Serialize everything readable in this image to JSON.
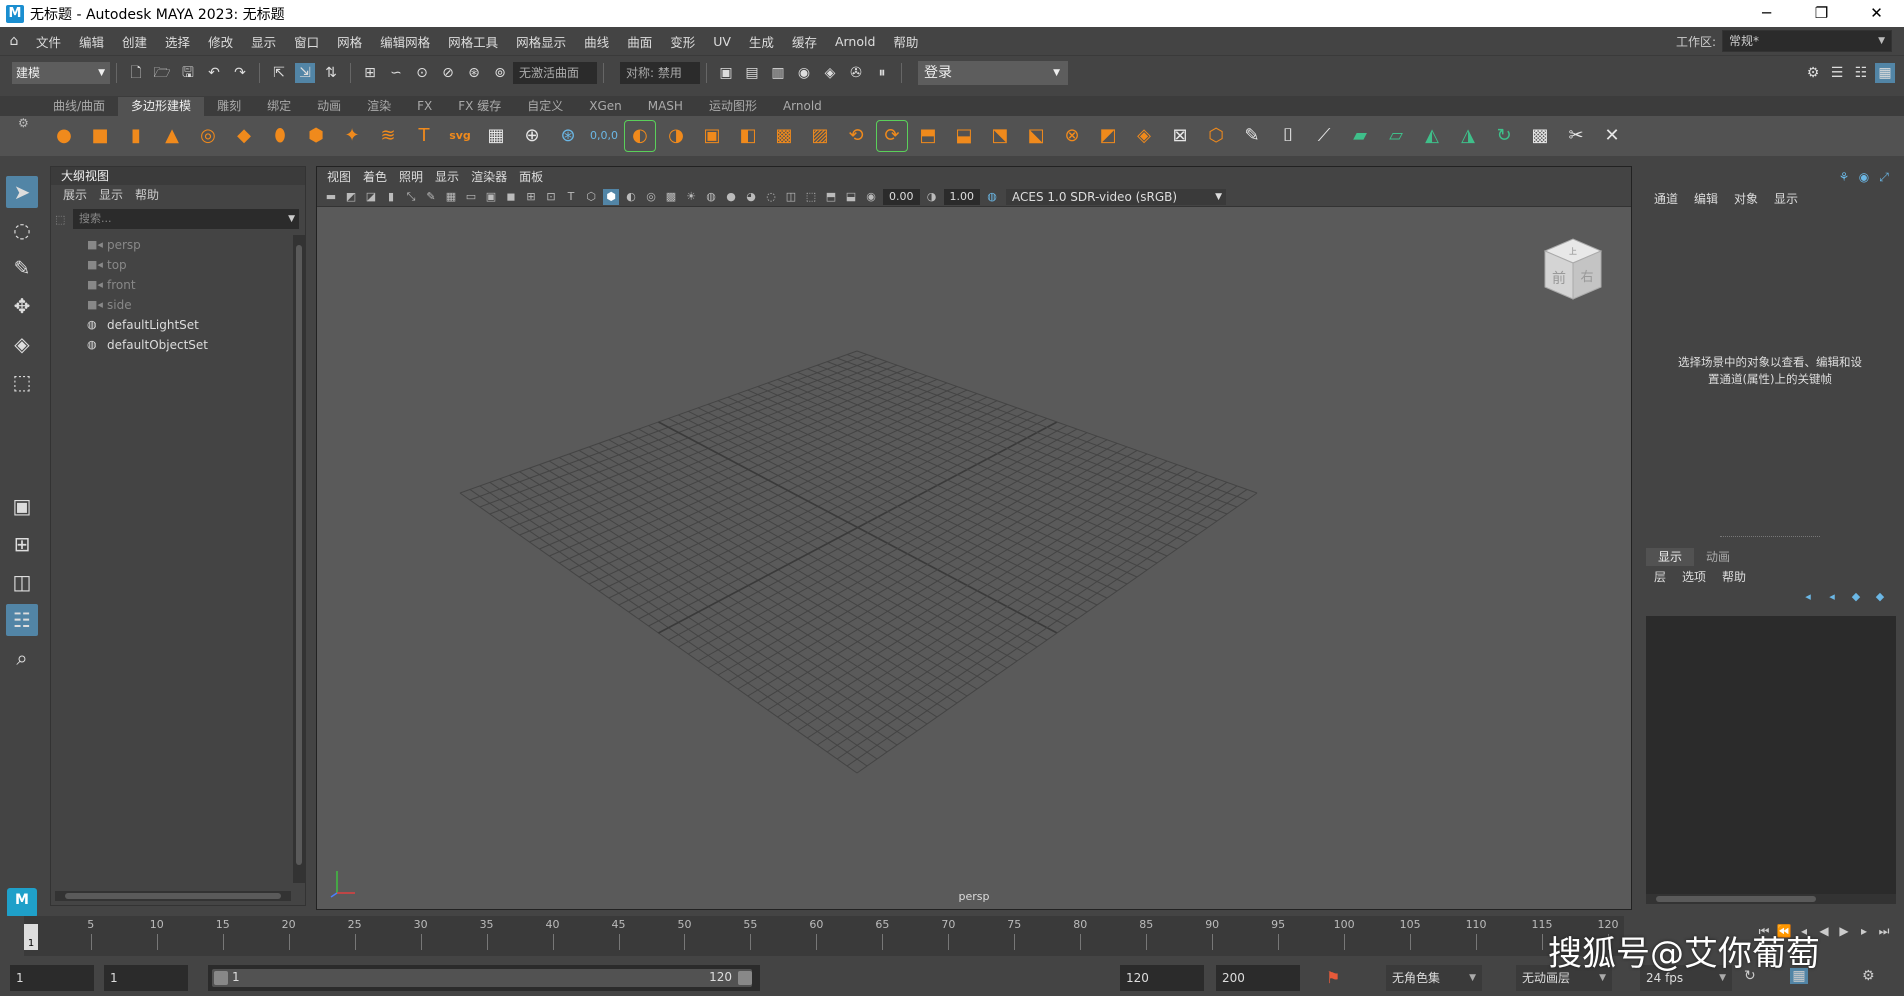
{
  "window": {
    "title": "无标题 - Autodesk MAYA 2023: 无标题",
    "logo": "M",
    "controls": [
      "─",
      "❐",
      "✕"
    ]
  },
  "menubar": {
    "items": [
      "文件",
      "编辑",
      "创建",
      "选择",
      "修改",
      "显示",
      "窗口",
      "网格",
      "编辑网格",
      "网格工具",
      "网格显示",
      "曲线",
      "曲面",
      "变形",
      "UV",
      "生成",
      "缓存",
      "Arnold",
      "帮助"
    ],
    "workspace_label": "工作区:",
    "workspace_value": "常规*"
  },
  "statusline": {
    "mode": "建模",
    "live_surface": "无激活曲面",
    "symmetry": "对称: 禁用",
    "login": "登录"
  },
  "shelf": {
    "tabs": [
      "曲线/曲面",
      "多边形建模",
      "雕刻",
      "绑定",
      "动画",
      "渲染",
      "FX",
      "FX 缓存",
      "自定义",
      "XGen",
      "MASH",
      "运动图形",
      "Arnold"
    ],
    "active_tab": "多边形建模"
  },
  "outliner": {
    "title": "大纲视图",
    "menu": [
      "展示",
      "显示",
      "帮助"
    ],
    "search_placeholder": "搜索...",
    "items": [
      {
        "label": "persp",
        "icon": "camera-icon",
        "dim": true
      },
      {
        "label": "top",
        "icon": "camera-icon",
        "dim": true
      },
      {
        "label": "front",
        "icon": "camera-icon",
        "dim": true
      },
      {
        "label": "side",
        "icon": "camera-icon",
        "dim": true
      },
      {
        "label": "defaultLightSet",
        "icon": "set-icon",
        "dim": false
      },
      {
        "label": "defaultObjectSet",
        "icon": "set-icon",
        "dim": false
      }
    ]
  },
  "viewport": {
    "menu": [
      "视图",
      "着色",
      "照明",
      "显示",
      "渲染器",
      "面板"
    ],
    "exposure": "0.00",
    "gamma": "1.00",
    "colorspace": "ACES 1.0 SDR-video (sRGB)",
    "camera_label": "persp",
    "viewcube_front": "前",
    "viewcube_right": "右",
    "viewcube_top": "上"
  },
  "channelbox": {
    "menu": [
      "通道",
      "编辑",
      "对象",
      "显示"
    ],
    "message_line1": "选择场景中的对象以查看、编辑和设",
    "message_line2": "置通道(属性)上的关键帧",
    "layer_tabs": [
      "显示",
      "动画"
    ],
    "layer_menu": [
      "层",
      "选项",
      "帮助"
    ]
  },
  "timeslider": {
    "current_frame": "1",
    "ticks": [
      "5",
      "10",
      "15",
      "20",
      "25",
      "30",
      "35",
      "40",
      "45",
      "50",
      "55",
      "60",
      "65",
      "70",
      "75",
      "80",
      "85",
      "90",
      "95",
      "100",
      "105",
      "110",
      "115",
      "120"
    ]
  },
  "rangebar": {
    "start": "1",
    "current": "1",
    "range_start": "1",
    "range_end": "120",
    "anim_end": "120",
    "playback_end": "200",
    "character_set": "无角色集",
    "anim_layer": "无动画层",
    "fps": "24 fps"
  },
  "watermark": "搜狐号@艾你葡萄",
  "colors": {
    "accent": "#5285a6",
    "shelf_icon": "#f08a1c",
    "panel": "#444444",
    "viewport_bg": "#5a5a5a"
  }
}
